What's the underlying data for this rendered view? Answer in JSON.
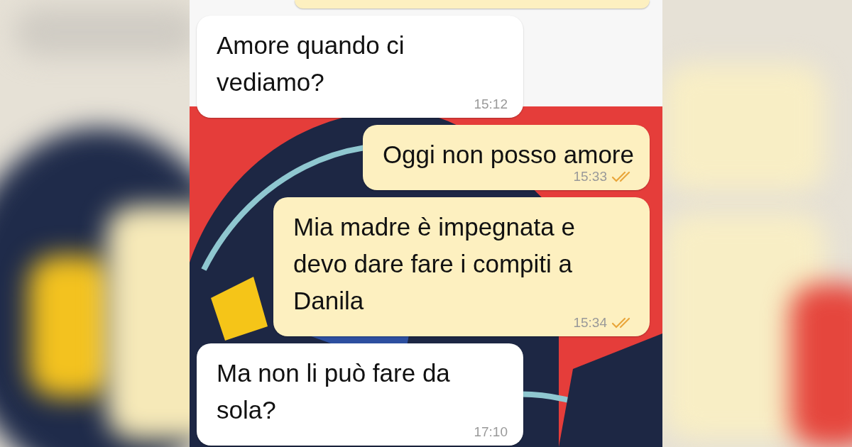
{
  "messages": [
    {
      "kind": "incoming",
      "text": "Amore quando ci vediamo?",
      "time": "15:12"
    },
    {
      "kind": "outgoing",
      "text": "Oggi non posso amore",
      "time": "15:33",
      "read": true
    },
    {
      "kind": "outgoing",
      "text": "Mia madre è impegnata e devo dare fare i compiti a Danila",
      "time": "15:34",
      "read": true
    },
    {
      "kind": "incoming",
      "text": "Ma non li può fare da sola?",
      "time": "17:10"
    }
  ]
}
